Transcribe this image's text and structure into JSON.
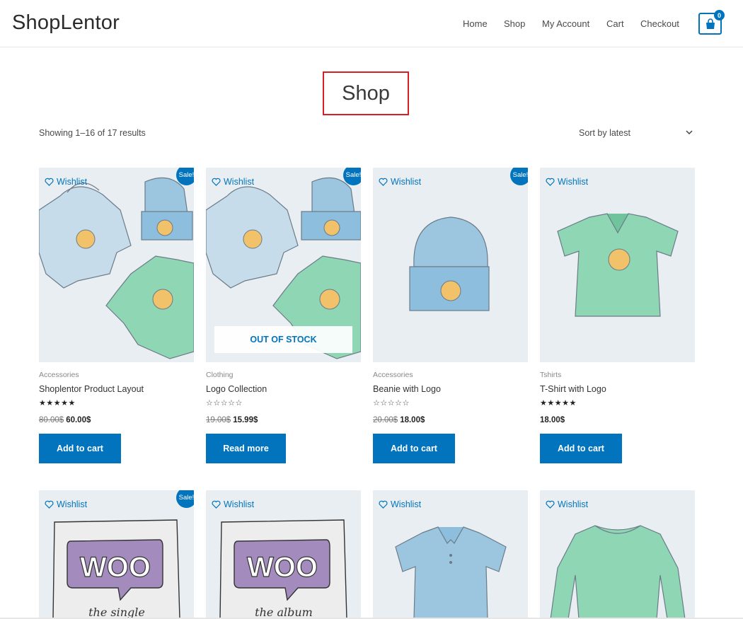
{
  "site": {
    "logo": "ShopLentor"
  },
  "nav": [
    "Home",
    "Shop",
    "My Account",
    "Cart",
    "Checkout"
  ],
  "cart": {
    "count": "0"
  },
  "page": {
    "title": "Shop",
    "result_count": "Showing 1–16 of 17 results",
    "sort_label": "Sort by latest"
  },
  "products": [
    {
      "category": "Accessories",
      "title": "Shoplentor Product Layout",
      "rating": "★★★★★",
      "old_price": "80.00$",
      "price": "60.00$",
      "button": "Add to cart",
      "sale": "Sale!",
      "wishlist": "Wishlist"
    },
    {
      "category": "Clothing",
      "title": "Logo Collection",
      "rating": "☆☆☆☆☆",
      "old_price": "19.00$",
      "price": "15.99$",
      "button": "Read more",
      "sale": "Sale!",
      "wishlist": "Wishlist",
      "stock": "OUT OF STOCK"
    },
    {
      "category": "Accessories",
      "title": "Beanie with Logo",
      "rating": "☆☆☆☆☆",
      "old_price": "20.00$",
      "price": "18.00$",
      "button": "Add to cart",
      "sale": "Sale!",
      "wishlist": "Wishlist"
    },
    {
      "category": "Tshirts",
      "title": "T-Shirt with Logo",
      "rating": "★★★★★",
      "old_price": "",
      "price": "18.00$",
      "button": "Add to cart",
      "wishlist": "Wishlist"
    },
    {
      "wishlist": "Wishlist",
      "sale": "Sale!",
      "image_text": "WOO",
      "image_script": "the single"
    },
    {
      "wishlist": "Wishlist",
      "image_text": "WOO",
      "image_script": "the album"
    },
    {
      "wishlist": "Wishlist"
    },
    {
      "wishlist": "Wishlist"
    }
  ],
  "colors": {
    "accent": "#0274be",
    "highlight": "#d81f26",
    "woo_purple": "#a48bbd"
  }
}
